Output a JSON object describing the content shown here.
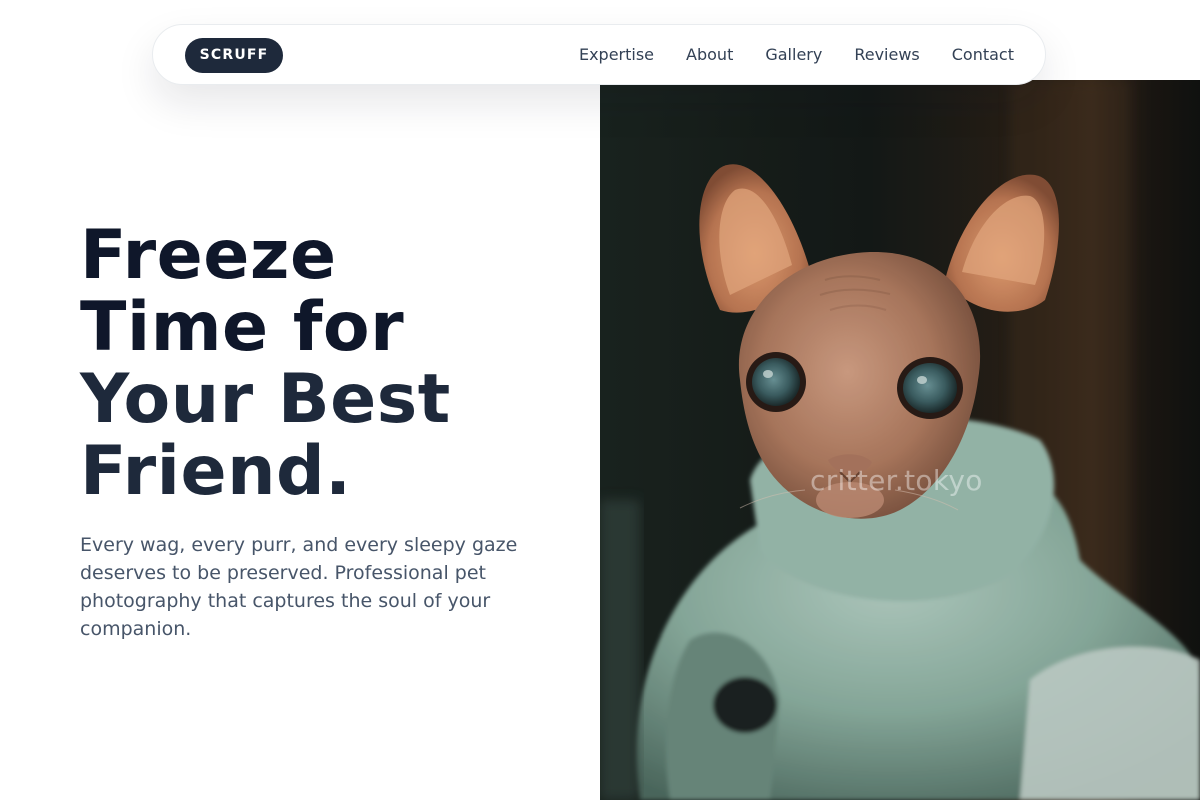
{
  "nav": {
    "logo": "SCRUFF",
    "links": [
      "Expertise",
      "About",
      "Gallery",
      "Reviews",
      "Contact"
    ]
  },
  "hero": {
    "headline_lines": [
      "Freeze",
      "Time for",
      "Your Best",
      "Friend."
    ],
    "subtext": "Every wag, every purr, and every sleepy gaze deserves to be preserved. Professional pet photography that captures the soul of your companion."
  },
  "photo": {
    "subject": "hairless sphynx cat wearing a mint sweater",
    "watermark": "critter.tokyo"
  },
  "colors": {
    "logo_bg": "#1e293b",
    "headline": "#0f172a",
    "body_text": "#475569",
    "nav_text": "#334155"
  }
}
